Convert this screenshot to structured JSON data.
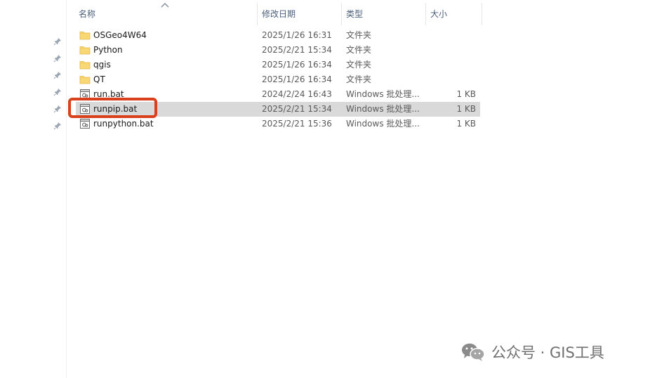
{
  "header": {
    "name": "名称",
    "date_modified": "修改日期",
    "type": "类型",
    "size": "大小"
  },
  "files": [
    {
      "name": "OSGeo4W64",
      "date": "2025/1/26 16:31",
      "type": "文件夹",
      "size": "",
      "kind": "folder-icon"
    },
    {
      "name": "Python",
      "date": "2025/2/21 15:34",
      "type": "文件夹",
      "size": "",
      "kind": "folder-icon"
    },
    {
      "name": "qgis",
      "date": "2025/1/26 16:34",
      "type": "文件夹",
      "size": "",
      "kind": "folder-icon"
    },
    {
      "name": "QT",
      "date": "2025/1/26 16:34",
      "type": "文件夹",
      "size": "",
      "kind": "folder-icon"
    },
    {
      "name": "run.bat",
      "date": "2024/2/24 16:43",
      "type": "Windows 批处理...",
      "size": "1 KB",
      "kind": "batch-file-icon"
    },
    {
      "name": "runpip.bat",
      "date": "2025/2/21 15:34",
      "type": "Windows 批处理...",
      "size": "1 KB",
      "kind": "batch-file-icon",
      "selected": true
    },
    {
      "name": "runpython.bat",
      "date": "2025/2/21 15:36",
      "type": "Windows 批处理...",
      "size": "1 KB",
      "kind": "batch-file-icon"
    }
  ],
  "watermark": {
    "text": "公众号 · GIS工具",
    "icon": "wechat-icon"
  },
  "colors": {
    "highlight": "#d9401c",
    "selection": "#d9d9d9",
    "folder": "#f8d775",
    "header_text": "#4c607a"
  }
}
